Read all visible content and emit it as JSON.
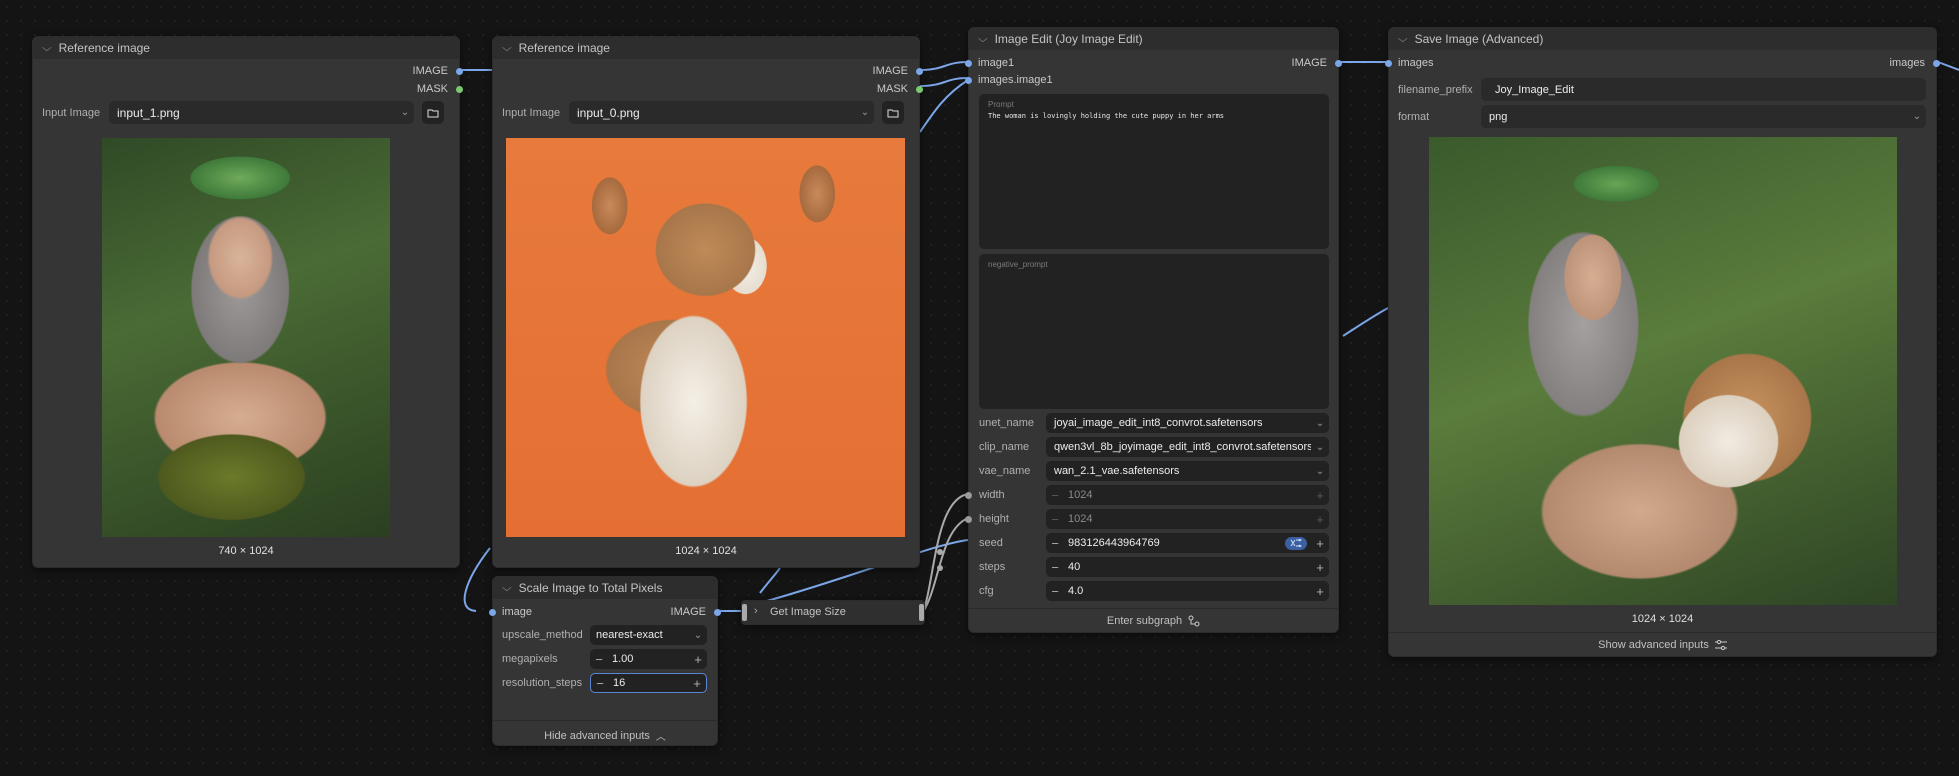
{
  "nodes": {
    "ref1": {
      "title": "Reference image",
      "outputs": [
        "IMAGE",
        "MASK"
      ],
      "input_label": "Input Image",
      "input_value": "input_1.png",
      "caption": "740 × 1024"
    },
    "ref2": {
      "title": "Reference image",
      "outputs": [
        "IMAGE",
        "MASK"
      ],
      "input_label": "Input Image",
      "input_value": "input_0.png",
      "caption": "1024 × 1024"
    },
    "edit": {
      "title": "Image Edit (Joy Image Edit)",
      "inputs": [
        "image1",
        "images.image1"
      ],
      "output": "IMAGE",
      "prompt_placeholder": "Prompt",
      "prompt_text": "The woman is lovingly holding the cute puppy in her arms",
      "negative_placeholder": "negative_prompt",
      "widgets": [
        {
          "label": "unet_name",
          "value": "joyai_image_edit_int8_convrot.safetensors"
        },
        {
          "label": "clip_name",
          "value": "qwen3vl_8b_joyimage_edit_int8_convrot.safetensors"
        },
        {
          "label": "vae_name",
          "value": "wan_2.1_vae.safetensors"
        },
        {
          "label": "width",
          "value": "1024"
        },
        {
          "label": "height",
          "value": "1024"
        },
        {
          "label": "seed",
          "value": "983126443964769"
        },
        {
          "label": "steps",
          "value": "40"
        },
        {
          "label": "cfg",
          "value": "4.0"
        }
      ],
      "footer": "Enter subgraph"
    },
    "save": {
      "title": "Save Image (Advanced)",
      "input": "images",
      "output": "images",
      "filename_label": "filename_prefix",
      "filename_value": "Joy_Image_Edit",
      "format_label": "format",
      "format_value": "png",
      "caption": "1024 × 1024",
      "footer": "Show advanced inputs"
    },
    "scale": {
      "title": "Scale Image to Total Pixels",
      "input": "image",
      "output": "IMAGE",
      "widgets": [
        {
          "label": "upscale_method",
          "value": "nearest-exact"
        },
        {
          "label": "megapixels",
          "value": "1.00"
        },
        {
          "label": "resolution_steps",
          "value": "16"
        }
      ],
      "footer": "Hide advanced inputs"
    },
    "getsize": {
      "title": "Get Image Size"
    }
  },
  "colors": {
    "canvas": "#141414",
    "node": "#353535",
    "header": "#2d2d2d",
    "wire": "#7ba6e8",
    "image_wire": "#7ba6e8",
    "mask": "#7bc96f",
    "seed_badge": "#3b5fa0"
  },
  "icons": [
    "chevron-down-icon",
    "folder-icon",
    "dropdown-arrow-icon",
    "minus-icon",
    "plus-icon",
    "random-seed-icon",
    "subgraph-icon",
    "settings-icon",
    "chevron-up-icon",
    "chevron-right-icon"
  ]
}
